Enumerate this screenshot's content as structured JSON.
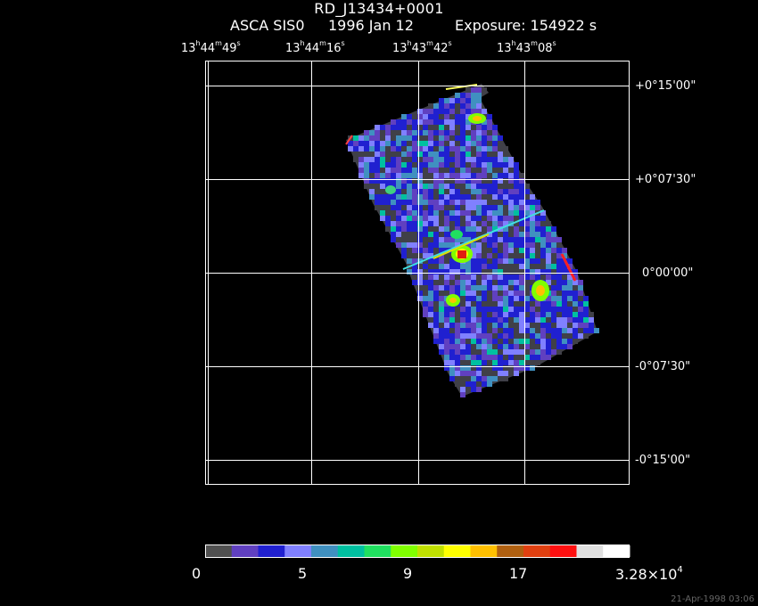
{
  "title": "RD_J13434+0001",
  "subtitle": {
    "instrument": "ASCA SIS0",
    "date": "1996 Jan 12",
    "exposure": "Exposure: 154922 s"
  },
  "ra_axis": [
    {
      "h": "13",
      "m": "44",
      "s": "49"
    },
    {
      "h": "13",
      "m": "44",
      "s": "16"
    },
    {
      "h": "13",
      "m": "43",
      "s": "42"
    },
    {
      "h": "13",
      "m": "43",
      "s": "08"
    }
  ],
  "dec_axis": [
    "+0°15'00\"",
    "+0°07'30\"",
    "0°00'00\"",
    "-0°07'30\"",
    "-0°15'00\""
  ],
  "colorbar": {
    "colors": [
      "#505050",
      "#6040c0",
      "#2020d0",
      "#8080ff",
      "#4090c0",
      "#00c0a0",
      "#20e060",
      "#80ff00",
      "#c0e000",
      "#ffff00",
      "#ffc000",
      "#b06010",
      "#e04010",
      "#ff1010",
      "#e0e0e0",
      "#ffffff"
    ],
    "labels": [
      "0",
      "5",
      "9",
      "17"
    ],
    "max_mantissa": "3.28×10",
    "max_exp": "4"
  },
  "footer": "21-Apr-1998 03:06"
}
